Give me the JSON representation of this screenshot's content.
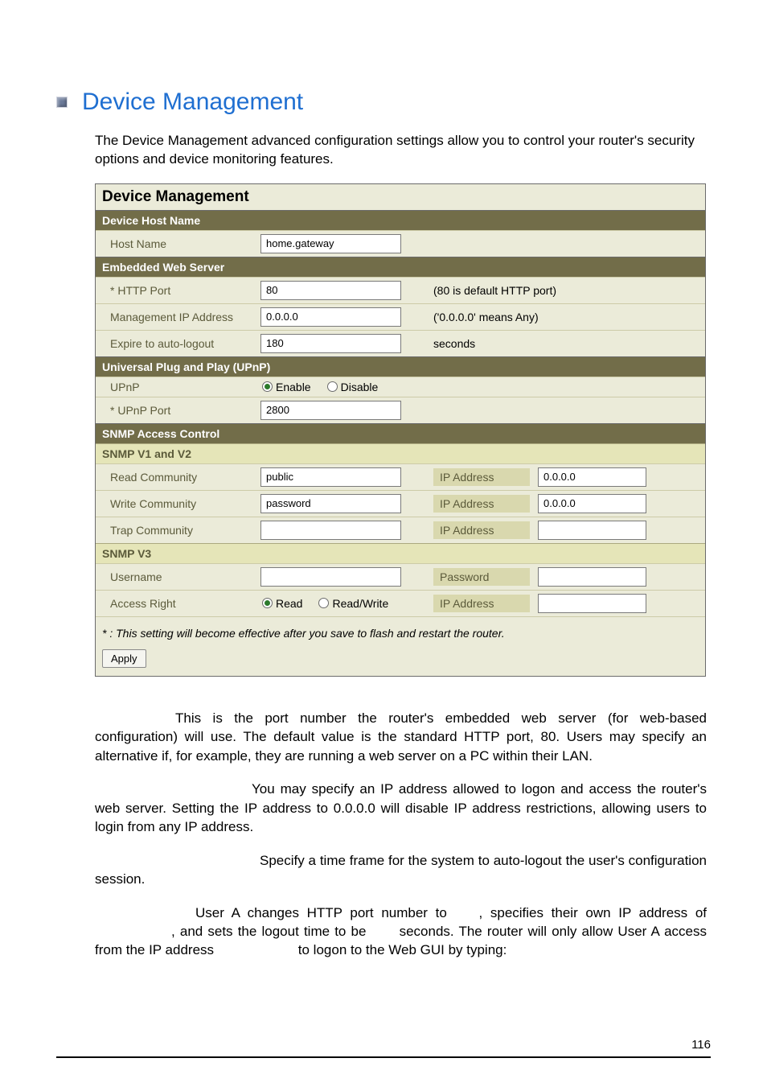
{
  "title": "Device Management",
  "intro": "The Device Management advanced configuration settings allow you to control your router's security options and device monitoring features.",
  "panel": {
    "title": "Device Management",
    "host": {
      "section": "Device Host Name",
      "host_name_label": "Host Name",
      "host_name_value": "home.gateway"
    },
    "web": {
      "section": "Embedded Web Server",
      "http_label": "* HTTP Port",
      "http_value": "80",
      "http_hint": "(80 is default HTTP port)",
      "mg_label": "Management IP Address",
      "mg_value": "0.0.0.0",
      "mg_hint": "('0.0.0.0' means Any)",
      "expire_label": "Expire to auto-logout",
      "expire_value": "180",
      "expire_hint": "seconds"
    },
    "upnp": {
      "section": "Universal Plug and Play (UPnP)",
      "upnp_label": "UPnP",
      "enable": "Enable",
      "disable": "Disable",
      "port_label": "* UPnP Port",
      "port_value": "2800"
    },
    "snmp": {
      "section": "SNMP Access Control",
      "v12": "SNMP V1 and V2",
      "read_label": "Read Community",
      "read_value": "public",
      "read_ip_label": "IP Address",
      "read_ip_value": "0.0.0.0",
      "write_label": "Write Community",
      "write_value": "password",
      "write_ip_label": "IP Address",
      "write_ip_value": "0.0.0.0",
      "trap_label": "Trap Community",
      "trap_value": "",
      "trap_ip_label": "IP Address",
      "trap_ip_value": "",
      "v3": "SNMP V3",
      "user_label": "Username",
      "user_value": "",
      "pass_label": "Password",
      "pass_value": "",
      "access_label": "Access Right",
      "read": "Read",
      "readwrite": "Read/Write",
      "access_ip_label": "IP Address",
      "access_ip_value": ""
    },
    "note": "* : This setting will become effective after you save to flash and restart the router.",
    "apply": "Apply"
  },
  "body": {
    "p1": "This is the port number the router's embedded web server (for web-based configuration) will use. The default value is the standard HTTP port, 80. Users may specify an alternative if, for example, they are running a web server on a PC within their LAN.",
    "p2": "You may specify an IP address allowed to logon and access the router's web server. Setting the IP address to 0.0.0.0 will disable IP address restrictions, allowing users to login from any IP address.",
    "p3": "Specify a time frame for the system to auto-logout the user's configuration session.",
    "p4a": "User A changes HTTP port number to",
    "p4b": ", specifies their own IP address of",
    "p4c": ", and sets the logout time to be",
    "p4d": "seconds.  The router will only allow User A access from the IP address",
    "p4e": "to logon to the Web GUI by typing:"
  },
  "page_num": "116"
}
